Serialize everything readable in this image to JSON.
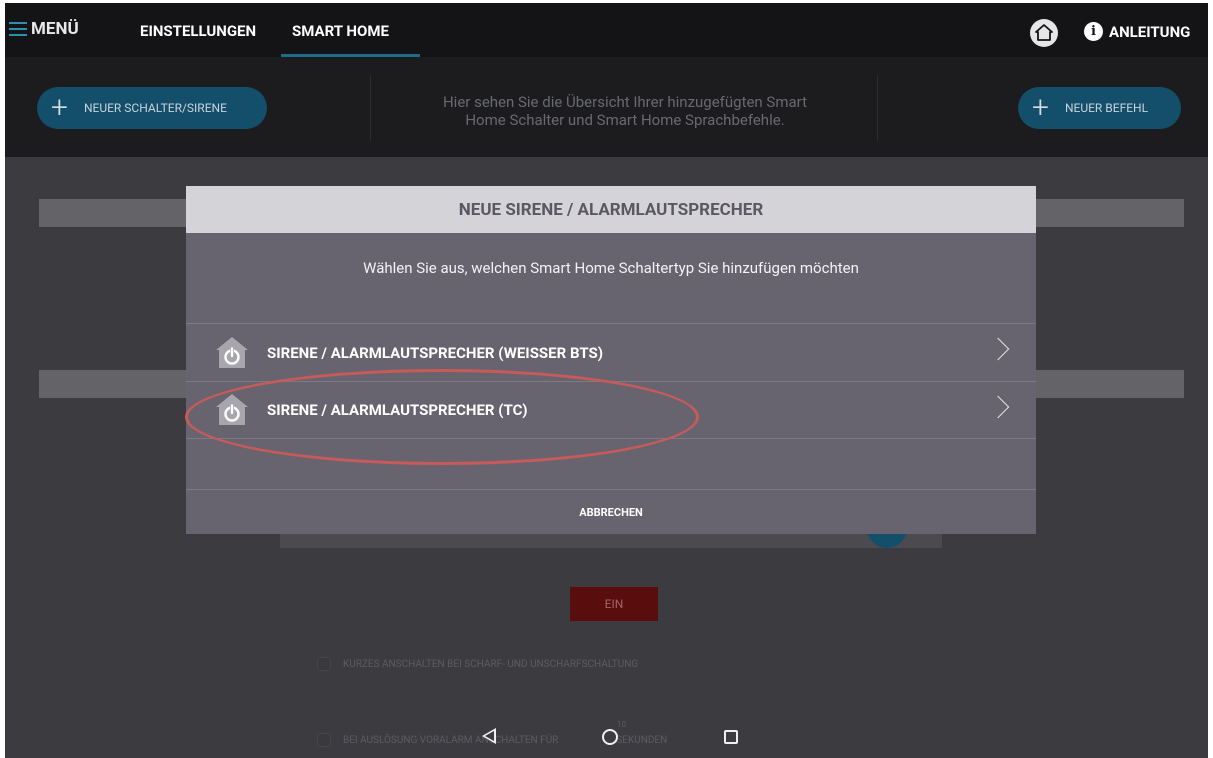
{
  "topbar": {
    "menu_label": "MENÜ",
    "tabs": [
      {
        "label": "EINSTELLUNGEN",
        "active": false
      },
      {
        "label": "SMART HOME",
        "active": true
      }
    ],
    "anleitung_label": "ANLEITUNG",
    "accent_color": "#1e6c8c"
  },
  "header": {
    "new_switch_label": "NEUER SCHALTER/SIRENE",
    "new_command_label": "NEUER BEFEHL",
    "info_line1": "Hier sehen Sie die Übersicht Ihrer hinzugefügten Smart",
    "info_line2": "Home Schalter und Smart Home Sprachbefehle."
  },
  "background": {
    "ein_button": "EIN",
    "option_short_switch": "KURZES ANSCHALTEN BEI SCHARF- UND UNSCHARFSCHALTUNG",
    "option_prealarm_prefix": "BEI AUSLÖSUNG VORALARM ANSCHALTEN FÜR",
    "option_prealarm_suffix": "SEKUNDEN",
    "prealarm_seconds": "10"
  },
  "dialog": {
    "title": "NEUE SIRENE / ALARMLAUTSPRECHER",
    "subtitle": "Wählen Sie aus, welchen Smart Home Schaltertyp Sie hinzufügen möchten",
    "options": [
      {
        "label": "SIRENE / ALARMLAUTSPRECHER (WEISSER BTS)",
        "icon": "house-power-icon"
      },
      {
        "label": "SIRENE / ALARMLAUTSPRECHER (TC)",
        "icon": "house-power-icon",
        "highlighted": true
      }
    ],
    "cancel_label": "ABBRECHEN"
  },
  "navbar": {
    "icons": [
      "back-icon",
      "home-icon",
      "recent-apps-icon"
    ]
  }
}
